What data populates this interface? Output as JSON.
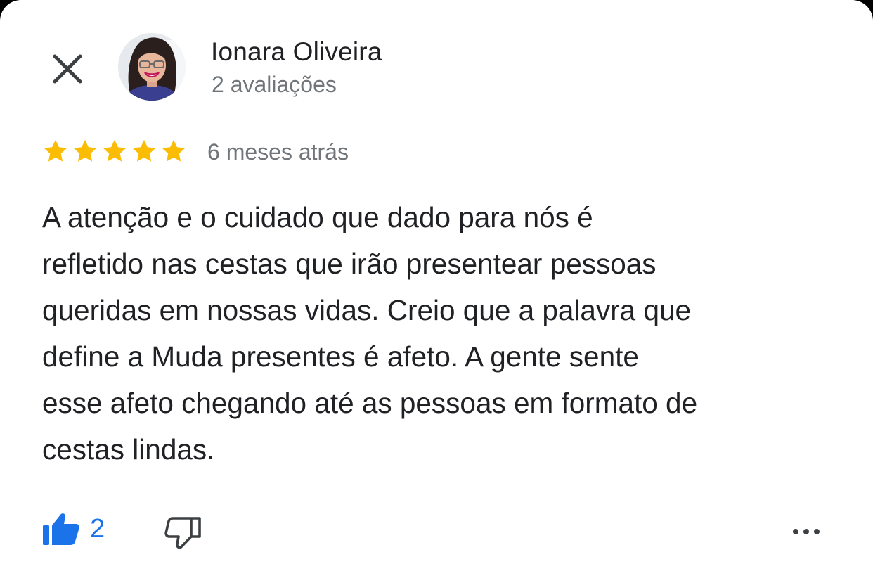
{
  "reviewer": {
    "name": "Ionara Oliveira",
    "review_count": "2 avaliações"
  },
  "review": {
    "rating": 5,
    "max_rating": 5,
    "date": "6 meses atrás",
    "lines": [
      "A atenção e o cuidado que dado para nós é",
      "refletido nas cestas que irão presentear pessoas",
      "queridas em nossas vidas. Creio que a palavra que",
      "define a Muda presentes é afeto. A gente sente",
      "esse afeto chegando até as pessoas em formato de",
      "cestas lindas."
    ]
  },
  "actions": {
    "like_count": "2",
    "like_icon": "thumbs-up-icon",
    "dislike_icon": "thumbs-down-icon",
    "more_icon": "more-horizontal-icon",
    "close_icon": "close-icon"
  },
  "colors": {
    "star": "#fbbc04",
    "accent": "#1a73e8",
    "secondary_text": "#70757a",
    "primary_text": "#202124"
  }
}
